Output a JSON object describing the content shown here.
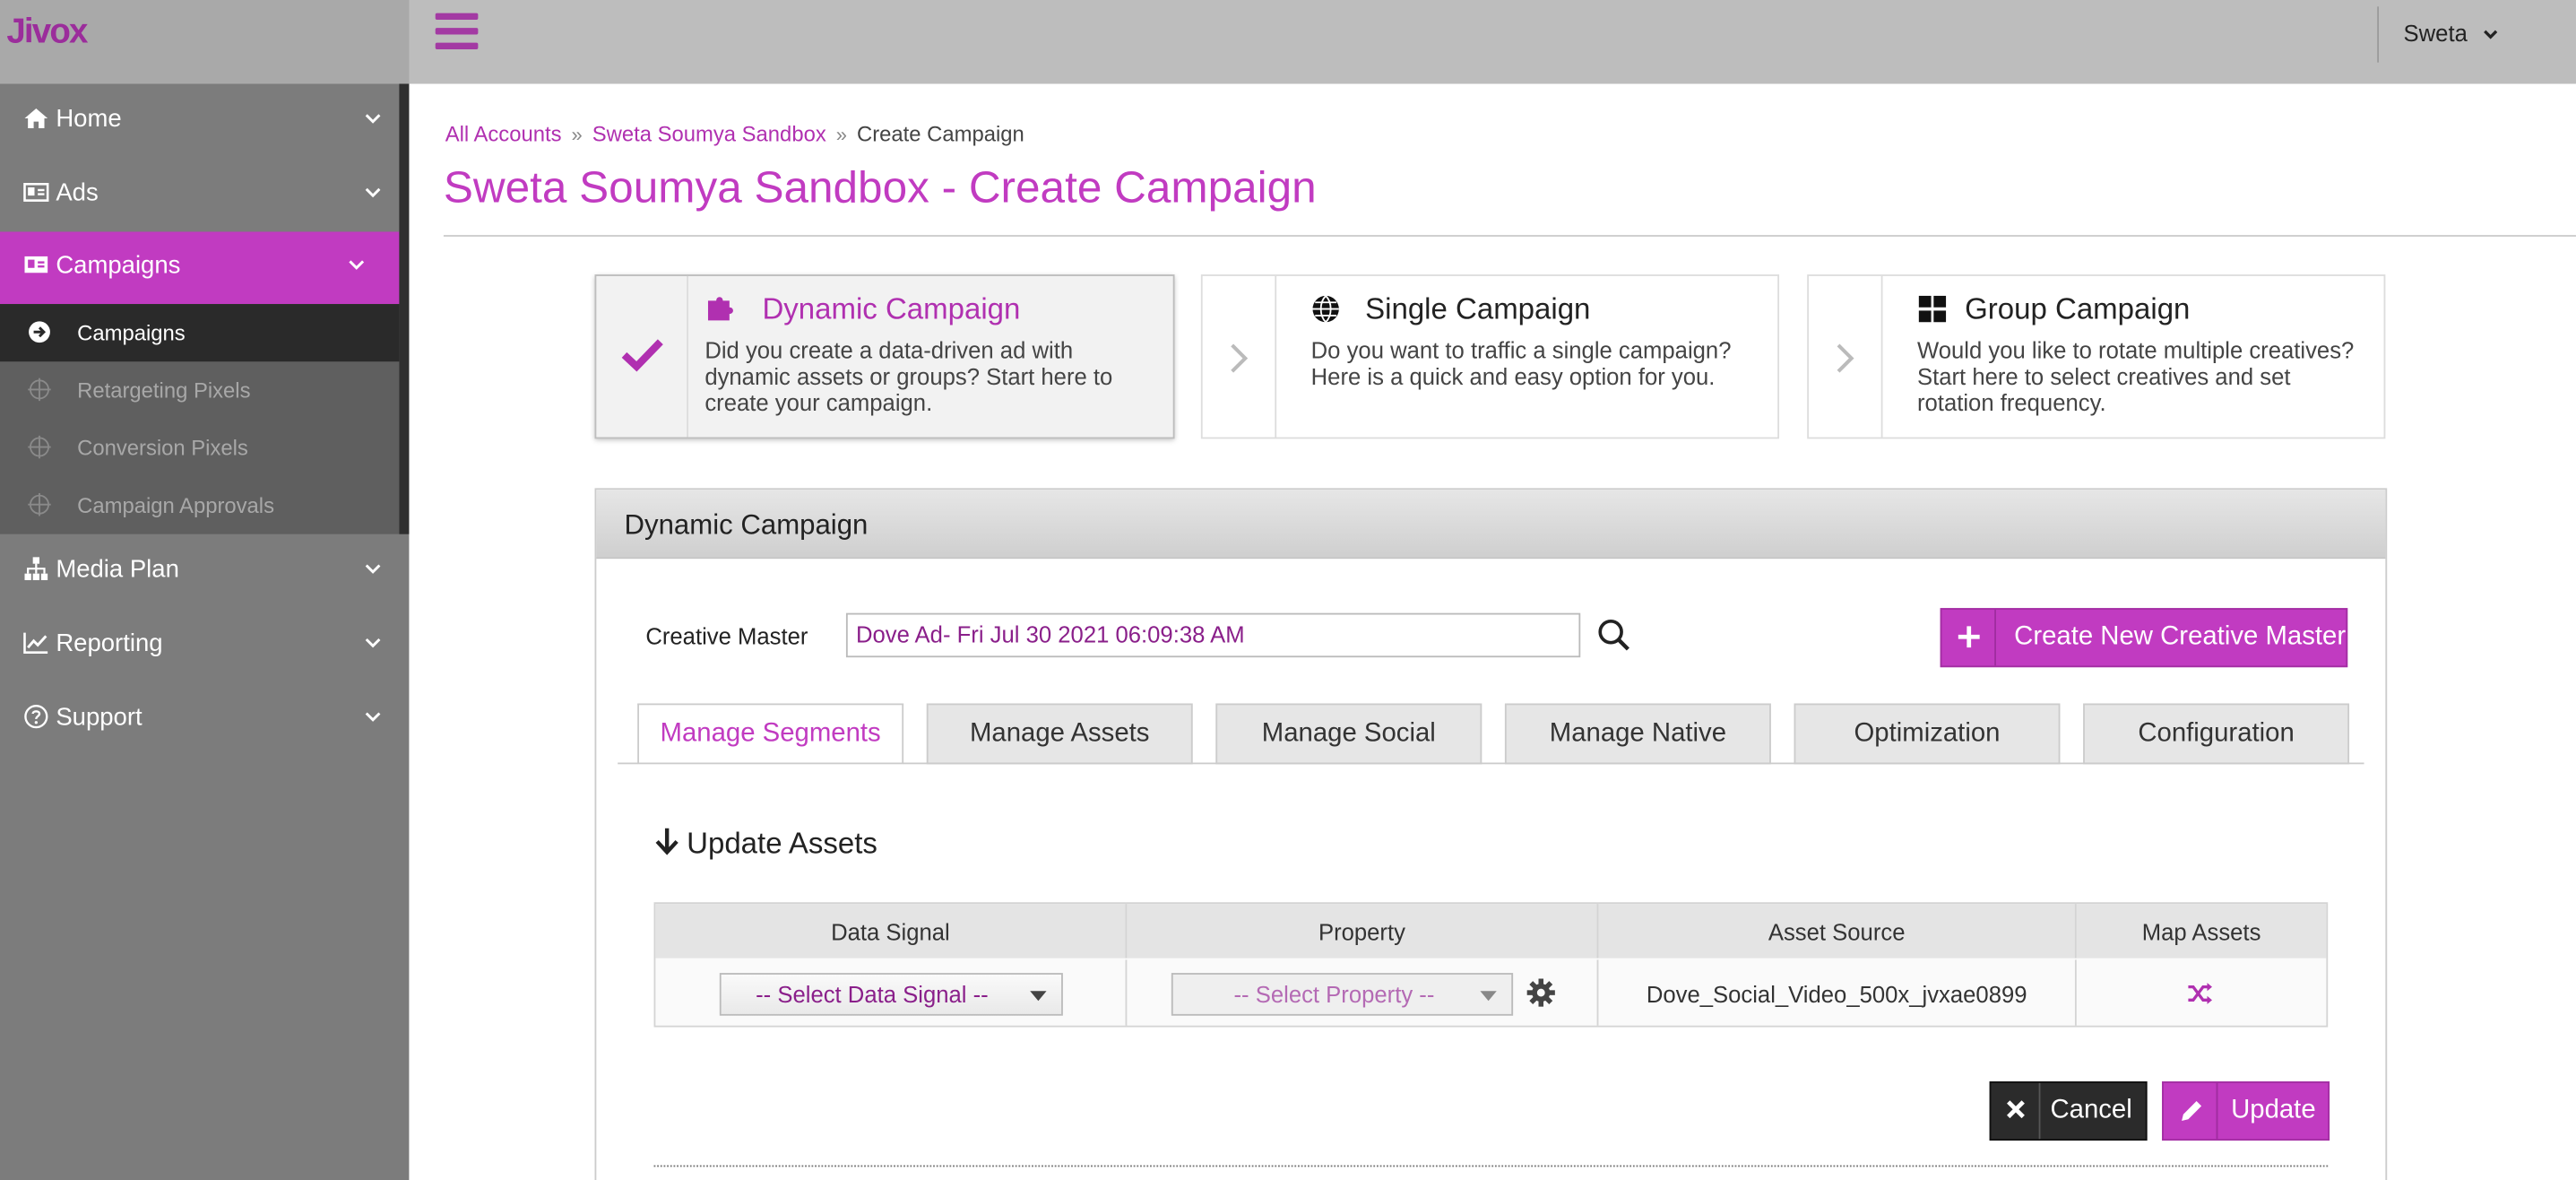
{
  "brand": {
    "logo_text": "Jivox"
  },
  "header": {
    "user_name": "Sweta"
  },
  "sidebar": {
    "items": [
      {
        "label": "Home",
        "icon": "home-icon"
      },
      {
        "label": "Ads",
        "icon": "id-card-icon"
      },
      {
        "label": "Campaigns",
        "icon": "campaign-card-icon",
        "active": true
      },
      {
        "label": "Media Plan",
        "icon": "sitemap-icon"
      },
      {
        "label": "Reporting",
        "icon": "line-chart-icon"
      },
      {
        "label": "Support",
        "icon": "question-circle-icon"
      }
    ],
    "campaign_subitems": [
      {
        "label": "Campaigns",
        "active": true
      },
      {
        "label": "Retargeting Pixels"
      },
      {
        "label": "Conversion Pixels"
      },
      {
        "label": "Campaign Approvals"
      }
    ]
  },
  "breadcrumb": {
    "items": [
      "All Accounts",
      "Sweta Soumya Sandbox",
      "Create Campaign"
    ],
    "separator": "»"
  },
  "page": {
    "title": "Sweta Soumya Sandbox - Create Campaign"
  },
  "campaign_types": [
    {
      "title": "Dynamic Campaign",
      "description": "Did you create a data-driven ad with dynamic assets or groups? Start here to create your campaign.",
      "icon": "puzzle-icon",
      "selected": true
    },
    {
      "title": "Single Campaign",
      "description": "Do you want to traffic a single campaign? Here is a quick and easy option for you.",
      "icon": "globe-icon",
      "selected": false
    },
    {
      "title": "Group Campaign",
      "description": "Would you like to rotate multiple creatives? Start here to select creatives and set rotation frequency.",
      "icon": "grid-icon",
      "selected": false
    }
  ],
  "panel": {
    "title": "Dynamic Campaign",
    "creative_master_label": "Creative Master",
    "creative_master_value": "Dove Ad- Fri Jul 30 2021 06:09:38 AM",
    "create_button": "Create New Creative Master",
    "tabs": [
      "Manage Segments",
      "Manage Assets",
      "Manage Social",
      "Manage Native",
      "Optimization",
      "Configuration"
    ],
    "active_tab": "Manage Segments",
    "section_title": "Update Assets",
    "table": {
      "headers": [
        "Data Signal",
        "Property",
        "Asset Source",
        "Map Assets"
      ],
      "row": {
        "data_signal": "-- Select Data Signal --",
        "property": "-- Select Property --",
        "asset_source": "Dove_Social_Video_500x_jvxae0899"
      }
    },
    "cancel_button": "Cancel",
    "update_button": "Update"
  },
  "colors": {
    "accent": "#c13bc1",
    "sidebar": "#7c7c7c",
    "sidebar_dark": "#5f5f5f",
    "topbar": "#bdbdbd"
  }
}
